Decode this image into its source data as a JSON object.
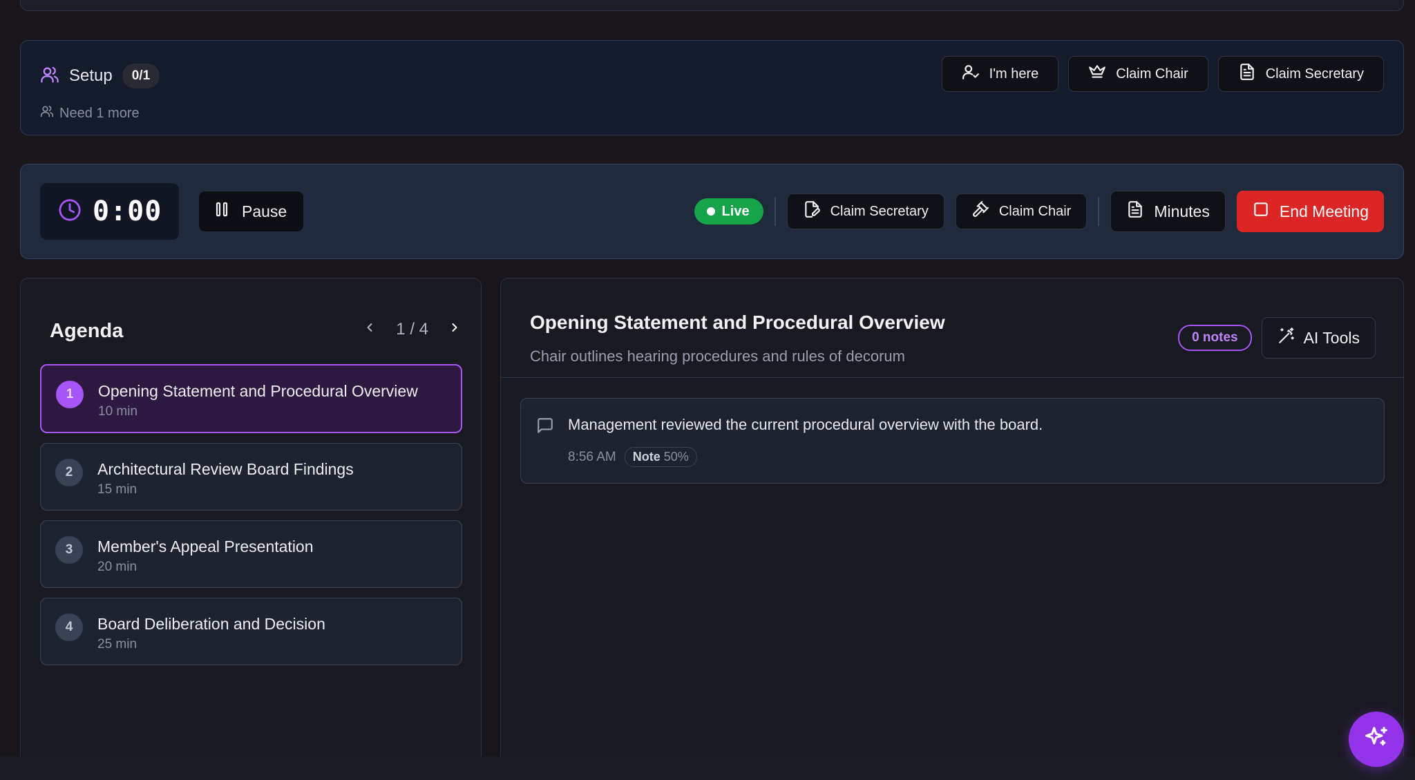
{
  "setup": {
    "title": "Setup",
    "count": "0/1",
    "need": "Need 1 more",
    "actions": {
      "im_here": "I'm here",
      "claim_chair": "Claim Chair",
      "claim_secretary": "Claim Secretary"
    }
  },
  "meeting_bar": {
    "timer": "0:00",
    "pause_label": "Pause",
    "live_label": "Live",
    "claim_secretary": "Claim Secretary",
    "claim_chair": "Claim Chair",
    "minutes_label": "Minutes",
    "end_label": "End Meeting"
  },
  "agenda": {
    "title": "Agenda",
    "page": "1 / 4",
    "items": [
      {
        "num": "1",
        "name": "Opening Statement and Procedural Overview",
        "duration": "10 min"
      },
      {
        "num": "2",
        "name": "Architectural Review Board Findings",
        "duration": "15 min"
      },
      {
        "num": "3",
        "name": "Member's Appeal Presentation",
        "duration": "20 min"
      },
      {
        "num": "4",
        "name": "Board Deliberation and Decision",
        "duration": "25 min"
      }
    ]
  },
  "main": {
    "title": "Opening Statement and Procedural Overview",
    "subtitle": "Chair outlines hearing procedures and rules of decorum",
    "notes_badge": "0 notes",
    "ai_tools": "AI Tools",
    "notes": [
      {
        "text": "Management reviewed the current procedural overview with the board.",
        "time": "8:56 AM",
        "tag": "Note",
        "confidence": "50%"
      }
    ]
  },
  "colors": {
    "accent": "#a855f7",
    "live": "#16a34a",
    "danger": "#dc2626"
  }
}
